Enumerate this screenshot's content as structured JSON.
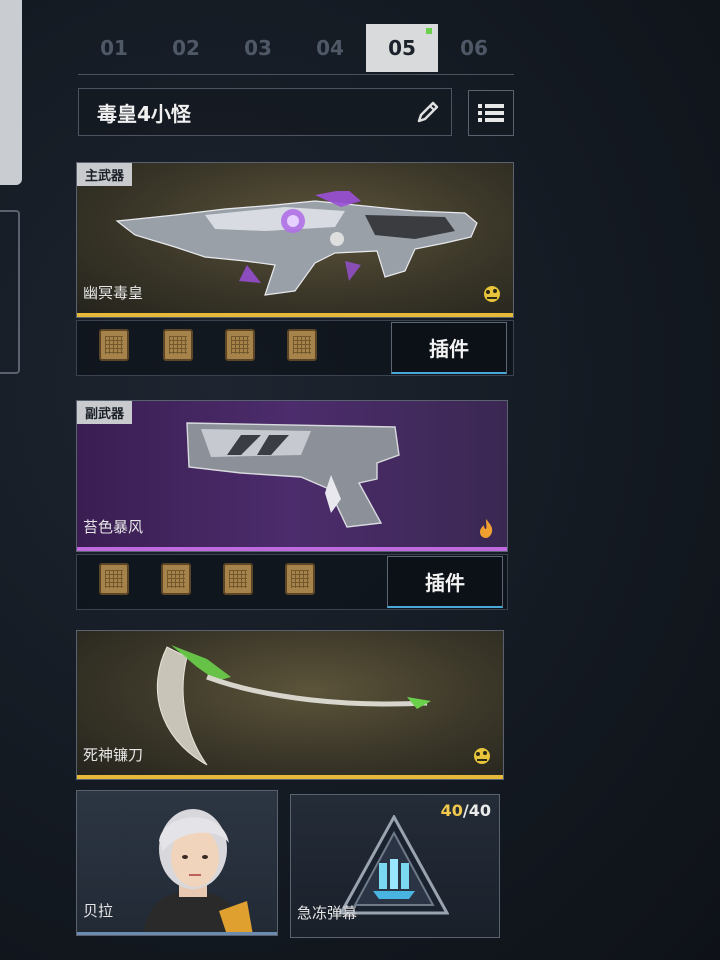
{
  "tabs": [
    "01",
    "02",
    "03",
    "04",
    "05",
    "06"
  ],
  "active_tab": "05",
  "loadout": {
    "name": "毒皇4小怪"
  },
  "primary": {
    "tag": "主武器",
    "name": "幽冥毒皇",
    "rarity_color": "#e6b93a",
    "plugin_label": "插件"
  },
  "secondary": {
    "tag": "副武器",
    "name": "苔色暴风",
    "rarity_color": "#c06ae0",
    "plugin_label": "插件"
  },
  "melee": {
    "name": "死神镰刀",
    "rarity_color": "#e6b93a"
  },
  "character": {
    "name": "贝拉"
  },
  "skill": {
    "name": "急冻弹幕",
    "count_current": "40",
    "count_sep": "/",
    "count_max": "40"
  }
}
